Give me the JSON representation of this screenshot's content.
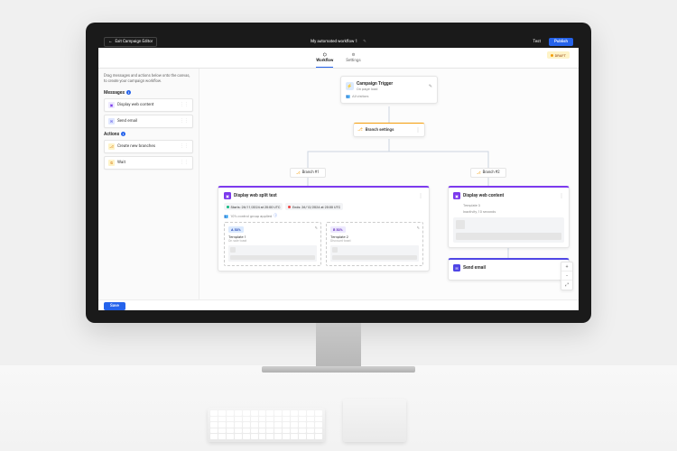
{
  "topbar": {
    "exit_label": "Exit Campaign Editor",
    "workflow_title": "My automated workflow 1",
    "test_label": "Test",
    "publish_label": "Publish"
  },
  "tabs": {
    "workflow": "Workflow",
    "settings": "Settings",
    "draft_badge": "DRAFT"
  },
  "sidebar": {
    "instructions": "Drag messages and actions below onto the canvas, to create your campaign workflow.",
    "messages_label": "Messages",
    "actions_label": "Actions",
    "items": {
      "web": "Display web content",
      "email": "Send email",
      "branch": "Create new branches",
      "wait": "Wait"
    }
  },
  "canvas": {
    "trigger": {
      "title": "Campaign Trigger",
      "subtitle": "On page load",
      "audience": "All visitors"
    },
    "branch_settings": "Branch settings",
    "branch_a": "Branch #1",
    "branch_b": "Branch #2",
    "split_test": {
      "title": "Display web split test",
      "start": "Starts: 26/11/2024 at 20:00 UTC",
      "end": "Ends: 26/12/2024 at 20:00 UTC",
      "control": "10% control group applied",
      "variant_a": {
        "badge": "A 50%",
        "name": "Template 1",
        "sub": "On sale toast"
      },
      "variant_b": {
        "badge": "B 50%",
        "name": "Template 2",
        "sub": "Discount toast"
      }
    },
    "right_web": {
      "title": "Display web content",
      "template": "Template 3",
      "meta": "Inactivity, 10 seconds"
    },
    "email_node": {
      "title": "Send email"
    }
  },
  "footer": {
    "save": "Save"
  }
}
